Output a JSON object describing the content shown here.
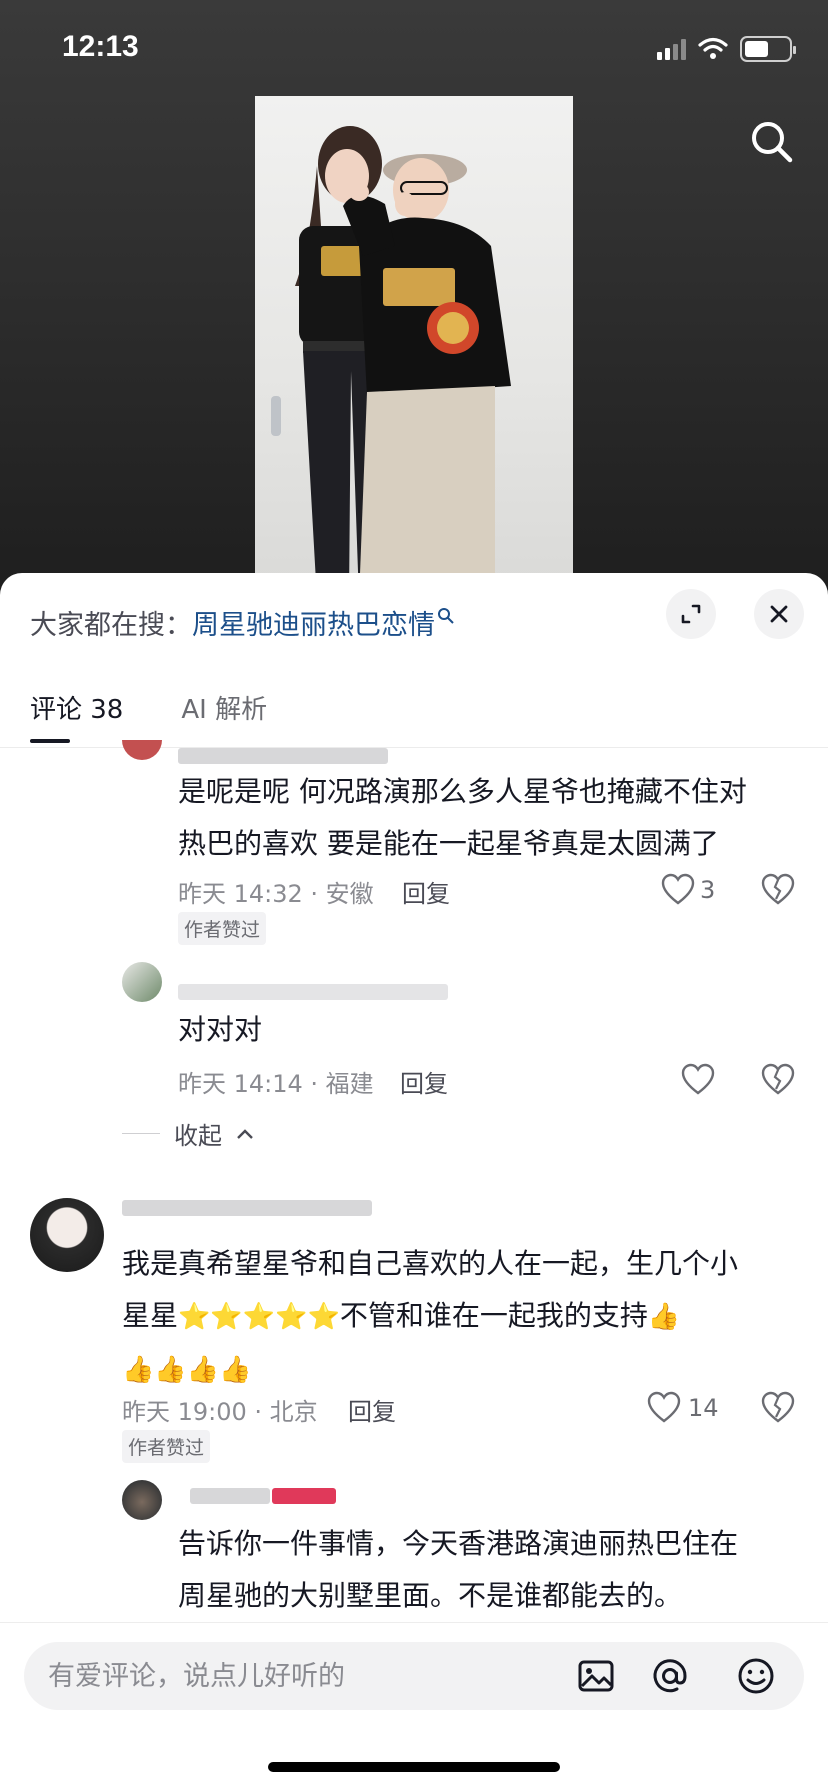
{
  "status_bar": {
    "time": "12:13"
  },
  "sheet": {
    "search_prefix": "大家都在搜：",
    "search_keyword": "周星驰迪丽热巴恋情",
    "tabs": [
      {
        "label": "评论 38",
        "active": true
      },
      {
        "label": "AI 解析",
        "active": false
      }
    ]
  },
  "comments": [
    {
      "text_line1": "是呢是呢 何况路演那么多人星爷也掩藏不住对",
      "text_line2": "热巴的喜欢 要是能在一起星爷真是太圆满了",
      "meta": "昨天 14:32 · 安徽",
      "reply": "回复",
      "likes": "3",
      "badge": "作者赞过"
    },
    {
      "text_line1": "对对对",
      "meta": "昨天 14:14 · 福建",
      "reply": "回复"
    },
    {
      "text_line1": "我是真希望星爷和自己喜欢的人在一起，生几个小",
      "text_line2_prefix": "星星",
      "text_line2_suffix": "不管和谁在一起我的支持",
      "meta": "昨天 19:00 · 北京",
      "reply": "回复",
      "likes": "14",
      "badge": "作者赞过"
    },
    {
      "text_line1": "告诉你一件事情，今天香港路演迪丽热巴住在",
      "text_line2": "周星驰的大别墅里面。不是谁都能去的。"
    }
  ],
  "collapse_label": "收起",
  "input": {
    "placeholder": "有爱评论，说点儿好听的"
  },
  "icons": {
    "search": "search-icon",
    "expand": "expand-icon",
    "close": "close-icon",
    "like": "heart-icon",
    "dislike": "broken-heart-icon",
    "image": "image-icon",
    "mention": "at-icon",
    "emoji": "emoji-icon"
  },
  "colors": {
    "keyword": "#1c4f8a",
    "text": "#161823",
    "meta": "#8a8b91"
  }
}
